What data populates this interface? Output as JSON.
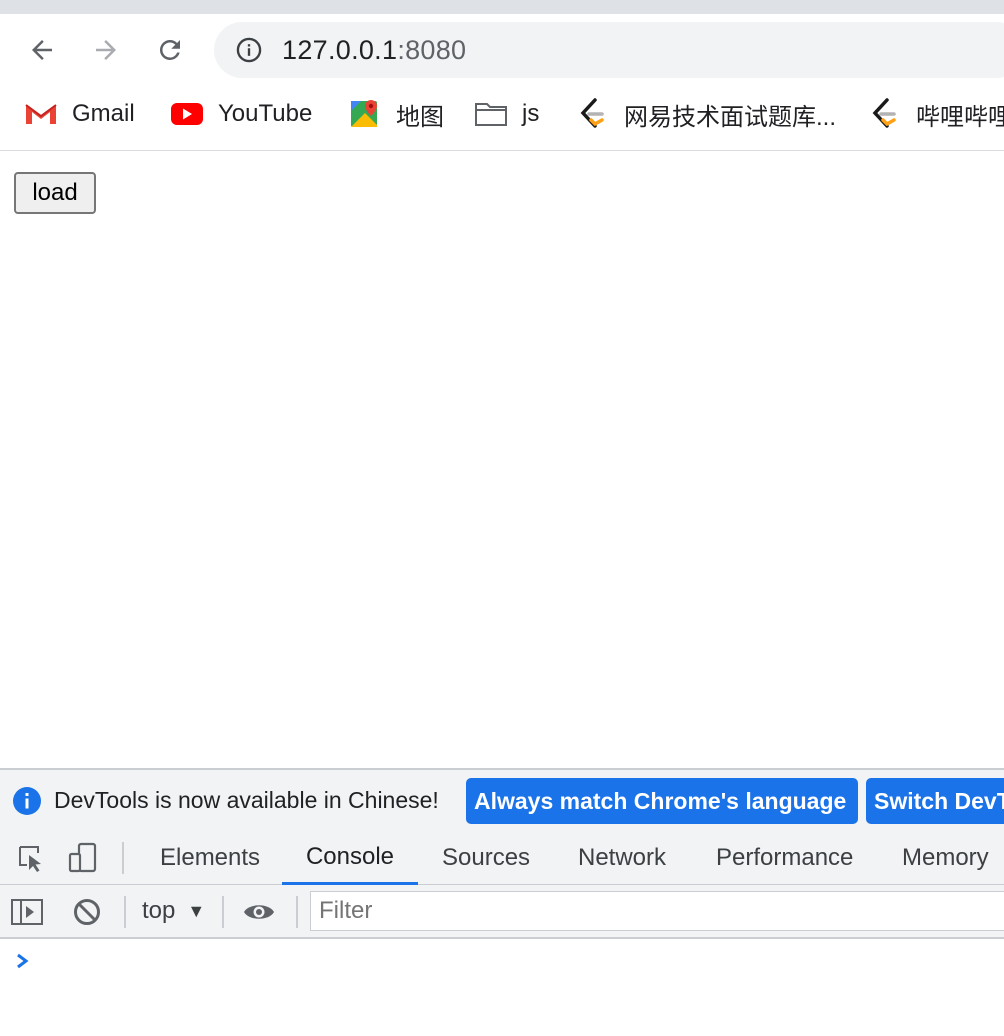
{
  "browser": {
    "url_host": "127.0.0.1",
    "url_port": ":8080"
  },
  "bookmarks": [
    {
      "label": "Gmail",
      "icon": "gmail-icon"
    },
    {
      "label": "YouTube",
      "icon": "youtube-icon"
    },
    {
      "label": "地图",
      "icon": "maps-icon"
    },
    {
      "label": "js",
      "icon": "folder-icon"
    },
    {
      "label": "网易技术面试题库...",
      "icon": "leetcode-icon"
    },
    {
      "label": "哔哩哔哩",
      "icon": "leetcode-icon"
    }
  ],
  "page": {
    "load_button": "load"
  },
  "devtools": {
    "infobar_text": "DevTools is now available in Chinese!",
    "match_language_button": "Always match Chrome's language",
    "switch_button": "Switch DevTools to Chinese",
    "tabs": [
      "Elements",
      "Console",
      "Sources",
      "Network",
      "Performance",
      "Memory"
    ],
    "active_tab": "Console",
    "context": "top",
    "filter_placeholder": "Filter"
  },
  "colors": {
    "accent": "#1a73e8",
    "toolbar_bg": "#f1f3f4"
  }
}
